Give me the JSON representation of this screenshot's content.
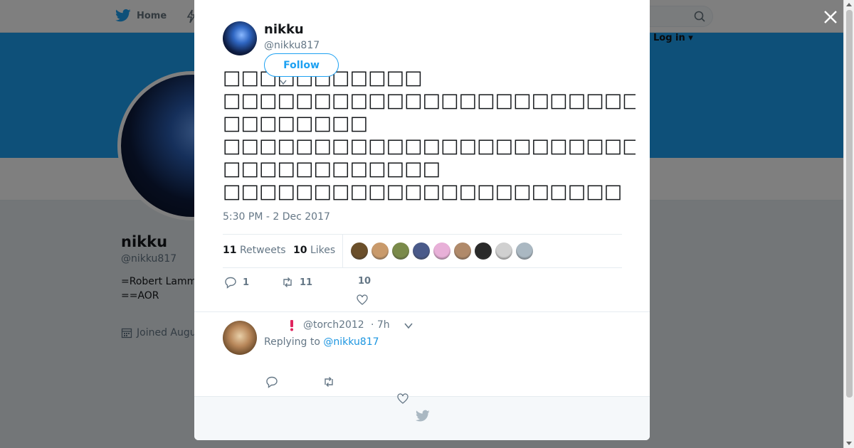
{
  "background": {
    "nav": {
      "home_label": "Home",
      "login_label": "Log in ▾"
    },
    "profile": {
      "name": "nikku",
      "handle": "@nikku817",
      "bio_line1": "=Robert Lamm",
      "bio_line2": "==AOR",
      "joined": "Joined Augu"
    }
  },
  "modal": {
    "author": {
      "name": "nikku",
      "handle": "@nikku817"
    },
    "follow_label": "Follow",
    "tweet_lines": [
      "□□□□□□□□□□□",
      "□□□□□□□□□□□□□□□□□□□□□□□□□",
      "□□□□□□□□",
      "□□□□□□□□□□□□□□□□□□□□□□□□□□□□□□□□□□□",
      "□□□□□□□□□□□□",
      "□□□□□□□□□□□□□□□□□□□□□□"
    ],
    "timestamp": "5:30 PM - 2 Dec 2017",
    "stats": {
      "retweets_count": "11",
      "retweets_label": "Retweets",
      "likes_count": "10",
      "likes_label": "Likes"
    },
    "liker_colors": [
      "#6b4f2a",
      "#c99a6b",
      "#7a8a4a",
      "#4a5a8a",
      "#e8b0d8",
      "#b08a6a",
      "#2a2a2a",
      "#d0d0d0",
      "#aab8c2"
    ],
    "actions": {
      "reply_count": "1",
      "retweet_count": "11",
      "like_count": "10"
    },
    "reply": {
      "handle": "@torch2012",
      "time": "· 7h",
      "replying_prefix": "Replying to",
      "replying_to": "@nikku817"
    }
  },
  "colors": {
    "accent": "#1da1f2",
    "link": "#1b95e0",
    "muted": "#657786",
    "alert": "#e0245e"
  }
}
